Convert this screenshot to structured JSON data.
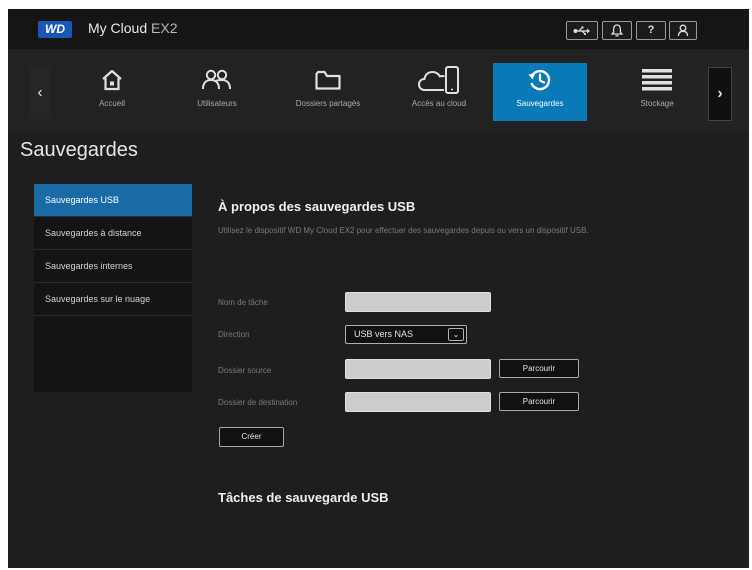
{
  "header": {
    "logo": "WD",
    "app_name": "My Cloud",
    "model": " EX2",
    "icons": [
      "usb-icon",
      "bell-icon",
      "help-icon",
      "user-icon"
    ],
    "help_label": "?"
  },
  "nav": {
    "items": [
      {
        "label": "Accueil",
        "icon": "home-icon",
        "active": false
      },
      {
        "label": "Utilisateurs",
        "icon": "users-icon",
        "active": false
      },
      {
        "label": "Dossiers partagés",
        "icon": "folder-icon",
        "active": false
      },
      {
        "label": "Accès au cloud",
        "icon": "cloud-device-icon",
        "active": false
      },
      {
        "label": "Sauvegardes",
        "icon": "backup-icon",
        "active": true
      },
      {
        "label": "Stockage",
        "icon": "storage-icon",
        "active": false
      }
    ],
    "accent": "#0a79b7"
  },
  "page": {
    "title": "Sauvegardes"
  },
  "sidebar": {
    "items": [
      {
        "label": "Sauvegardes USB",
        "active": true
      },
      {
        "label": "Sauvegardes à distance",
        "active": false
      },
      {
        "label": "Sauvegardes internes",
        "active": false
      },
      {
        "label": "Sauvegardes sur le nuage",
        "active": false
      }
    ]
  },
  "main": {
    "section_title": "À propos des sauvegardes USB",
    "description": "Utilisez le dispositif WD My Cloud EX2 pour effectuer des sauvegardes depuis ou vers un dispositif USB.",
    "form": {
      "task_name_label": "Nom de tâche",
      "task_name_value": "",
      "direction_label": "Direction",
      "direction_value": "USB vers NAS",
      "source_label": "Dossier source",
      "source_value": "",
      "destination_label": "Dossier de destination",
      "destination_value": "",
      "browse_label": "Parcourir",
      "create_label": "Créer"
    },
    "tasks_title": "Tâches de sauvegarde USB"
  }
}
